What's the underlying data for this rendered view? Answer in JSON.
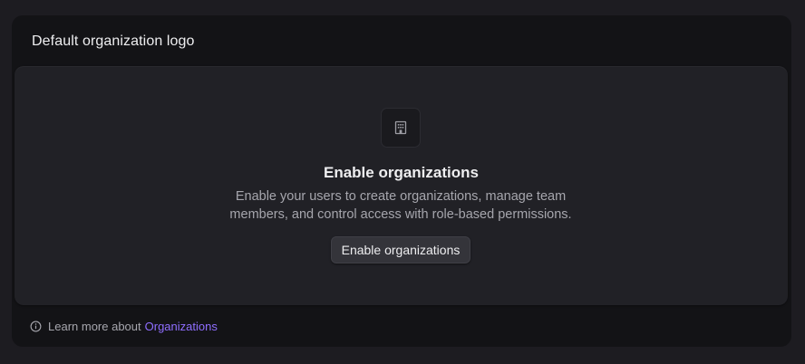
{
  "section": {
    "title": "Default organization logo"
  },
  "empty_state": {
    "icon": "building-icon",
    "title": "Enable organizations",
    "description": "Enable your users to create organizations, manage team members, and control access with role-based permissions.",
    "button_label": "Enable organizations"
  },
  "footer": {
    "icon": "info-icon",
    "text": "Learn more about",
    "link_label": "Organizations"
  },
  "colors": {
    "accent": "#8f6eff",
    "background": "#1d1c21",
    "card": "#131316",
    "panel": "#212126"
  }
}
